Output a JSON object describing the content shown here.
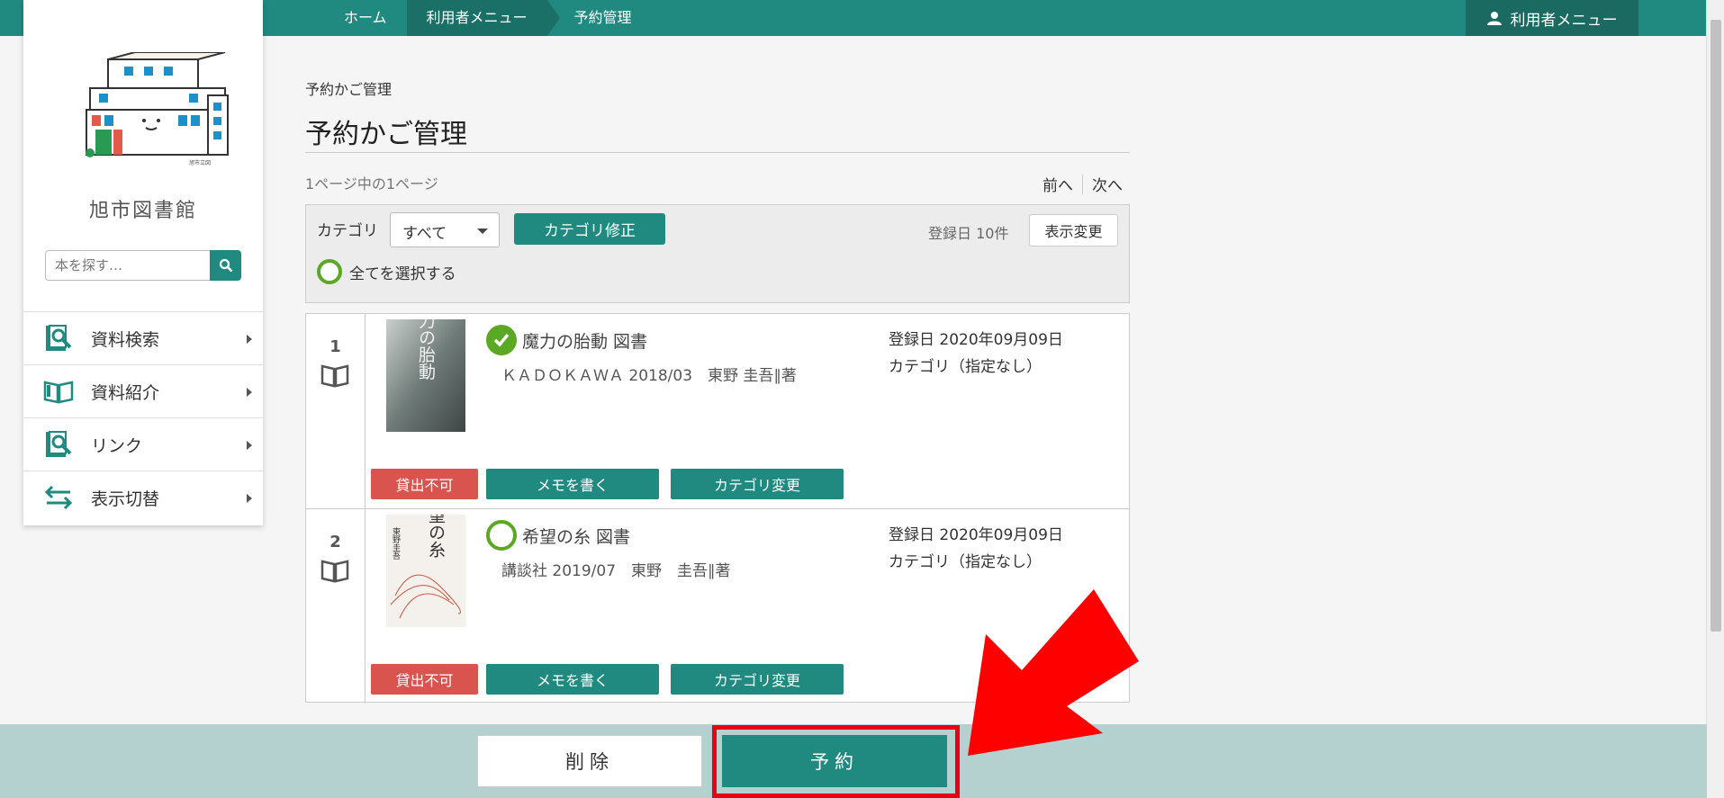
{
  "breadcrumb": [
    "ホーム",
    "利用者メニュー",
    "予約管理"
  ],
  "user_menu_label": "利用者メニュー",
  "library_name": "旭市図書館",
  "logo_caption": "旭市立図",
  "search": {
    "placeholder": "本を探す…"
  },
  "sidebar": {
    "items": [
      {
        "label": "資料検索",
        "icon": "search-book-icon"
      },
      {
        "label": "資料紹介",
        "icon": "open-book-icon"
      },
      {
        "label": "リンク",
        "icon": "link-book-icon"
      },
      {
        "label": "表示切替",
        "icon": "switch-arrows-icon"
      }
    ]
  },
  "page": {
    "subtitle": "予約かご管理",
    "title": "予約かご管理",
    "page_count": "1ページ中の1ページ",
    "prev": "前へ",
    "next": "次へ"
  },
  "filter": {
    "category_label": "カテゴリ",
    "category_value": "すべて",
    "edit_category": "カテゴリ修正",
    "sort_info": "登録日 10件",
    "change_display": "表示変更",
    "select_all": "全てを選択する"
  },
  "items": [
    {
      "number": "1",
      "title": "魔力の胎動 図書",
      "meta": "ＫＡＤＯＫＡＷＡ 2018/03　東野 圭吾∥著",
      "registered": "登録日 2020年09月09日",
      "category": "カテゴリ（指定なし）",
      "selected": true,
      "status": "貸出不可",
      "memo": "メモを書く",
      "change_category": "カテゴリ変更",
      "cover_text": "魔力の胎動"
    },
    {
      "number": "2",
      "title": "希望の糸 図書",
      "meta": "講談社 2019/07　東野　圭吾∥著",
      "registered": "登録日 2020年09月09日",
      "category": "カテゴリ（指定なし）",
      "selected": false,
      "status": "貸出不可",
      "memo": "メモを書く",
      "change_category": "カテゴリ変更",
      "cover_text": "希望の糸",
      "cover_author": "東野圭吾"
    }
  ],
  "actions": {
    "delete": "削除",
    "reserve": "予約"
  },
  "colors": {
    "accent": "#218a80",
    "danger": "#d9534f",
    "check": "#5ba824",
    "highlight": "#e60012"
  }
}
